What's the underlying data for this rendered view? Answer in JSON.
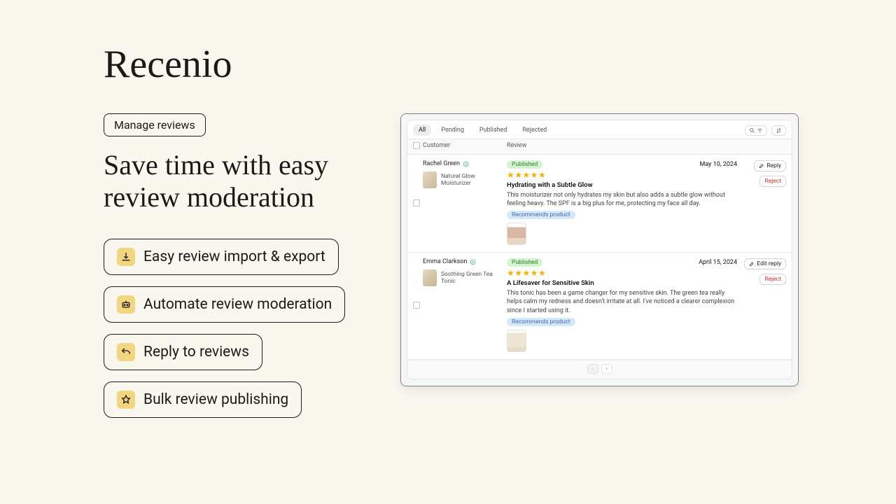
{
  "brand": "Recenio",
  "tag": "Manage reviews",
  "headline": "Save time with easy review moderation",
  "features": [
    {
      "label": "Easy review import & export"
    },
    {
      "label": "Automate review moderation"
    },
    {
      "label": "Reply to reviews"
    },
    {
      "label": "Bulk review publishing"
    }
  ],
  "app": {
    "tabs": [
      "All",
      "Pending",
      "Published",
      "Rejected"
    ],
    "active_tab": 0,
    "columns": {
      "customer": "Customer",
      "review": "Review"
    },
    "recommends_label": "Recommends product",
    "reply_label": "Reply",
    "edit_reply_label": "Edit reply",
    "reject_label": "Reject",
    "reviews": [
      {
        "status": "Published",
        "date": "May 10, 2024",
        "stars": 5,
        "customer": "Rachel Green",
        "product": "Natural Glow Moisturizer",
        "title": "Hydrating with a Subtle Glow",
        "body": "This moisturizer not only hydrates my skin but also adds a subtle glow without feeling heavy. The SPF is a big plus for me, protecting my face all day.",
        "has_reply": false
      },
      {
        "status": "Published",
        "date": "April 15, 2024",
        "stars": 5,
        "customer": "Emma Clarkson",
        "product": "Soothing Green Tea Tonic",
        "title": "A Lifesaver for Sensitive Skin",
        "body": "This tonic has been a game changer for my sensitive skin. The green tea really helps calm my redness and doesn't irritate at all. I've noticed a clearer complexion since I started using it.",
        "has_reply": true
      }
    ]
  }
}
